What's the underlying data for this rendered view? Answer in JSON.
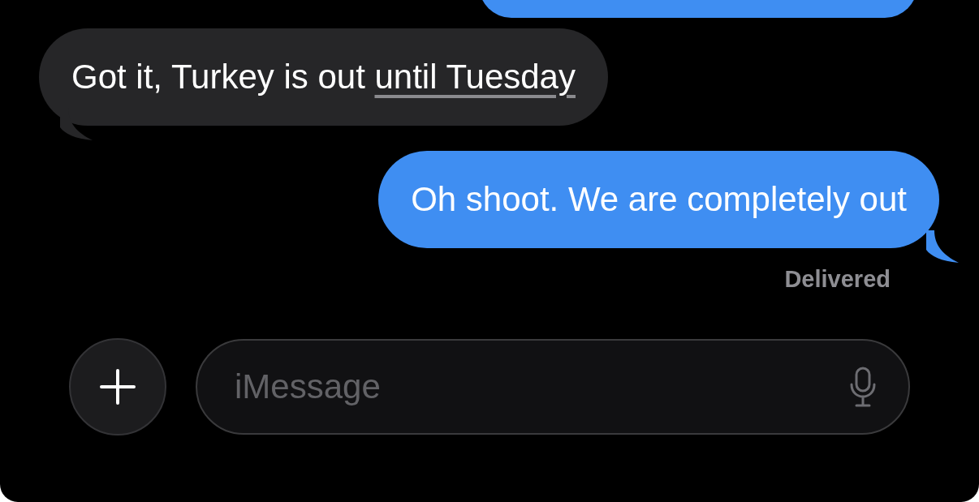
{
  "top_bubble": {
    "kind": "outgoing"
  },
  "messages": [
    {
      "kind": "incoming",
      "text": "Got it, Turkey is out ",
      "link": "until Tuesday"
    },
    {
      "kind": "outgoing",
      "text": "Oh shoot. We are completely out"
    }
  ],
  "status": "Delivered",
  "composer": {
    "placeholder": "iMessage"
  }
}
